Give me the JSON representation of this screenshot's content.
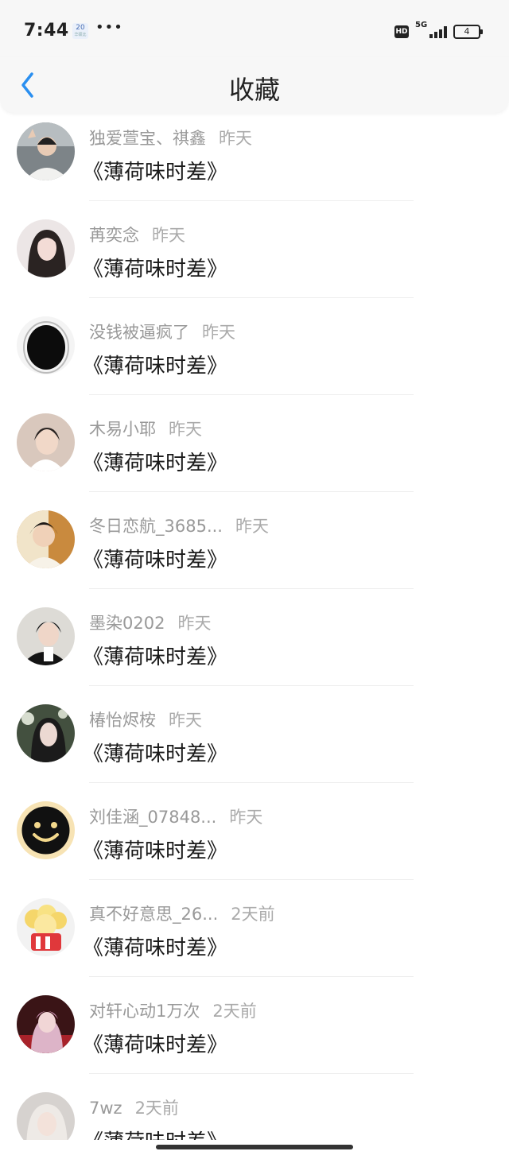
{
  "status": {
    "time": "7:44",
    "badge": "20",
    "badge_sub": "华硕比",
    "dots": "•••",
    "hd": "HD",
    "network": "5G",
    "battery": "4"
  },
  "nav": {
    "title": "收藏"
  },
  "items": [
    {
      "name": "独爱萱宝、祺鑫",
      "time": "昨天",
      "title": "《薄荷味时差》"
    },
    {
      "name": "苒奕念",
      "time": "昨天",
      "title": "《薄荷味时差》"
    },
    {
      "name": "没钱被逼疯了",
      "time": "昨天",
      "title": "《薄荷味时差》"
    },
    {
      "name": "木易小耶",
      "time": "昨天",
      "title": "《薄荷味时差》"
    },
    {
      "name": "冬日恋航_3685...",
      "time": "昨天",
      "title": "《薄荷味时差》"
    },
    {
      "name": "墨染0202",
      "time": "昨天",
      "title": "《薄荷味时差》"
    },
    {
      "name": "椿怡烬桉",
      "time": "昨天",
      "title": "《薄荷味时差》"
    },
    {
      "name": "刘佳涵_07848...",
      "time": "昨天",
      "title": "《薄荷味时差》"
    },
    {
      "name": "真不好意思_26...",
      "time": "2天前",
      "title": "《薄荷味时差》"
    },
    {
      "name": "对轩心动1万次",
      "time": "2天前",
      "title": "《薄荷味时差》"
    },
    {
      "name": "7wz",
      "time": "2天前",
      "title": "《薄荷味时差》"
    }
  ]
}
